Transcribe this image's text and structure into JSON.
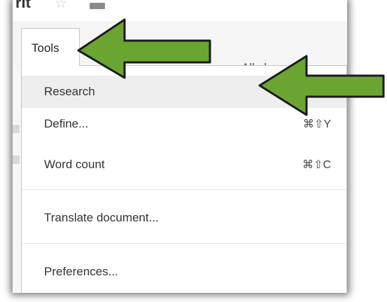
{
  "window": {
    "title_fragment": "rit",
    "star_glyph": "☆"
  },
  "menubar": {
    "tools_label": "Tools",
    "save_status": "All changes s"
  },
  "tools_menu": {
    "items": [
      {
        "label": "Research",
        "shortcut": "",
        "highlighted": true
      },
      {
        "label": "Define...",
        "shortcut": "⌘⇧Y",
        "highlighted": false
      },
      {
        "label": "Word count",
        "shortcut": "⌘⇧C",
        "highlighted": false
      },
      {
        "label": "Translate document...",
        "shortcut": "",
        "highlighted": false
      },
      {
        "label": "Preferences...",
        "shortcut": "",
        "highlighted": false
      }
    ]
  },
  "annotations": {
    "arrow_color": "#6aa531",
    "arrow_stroke": "#1a1a1a"
  }
}
